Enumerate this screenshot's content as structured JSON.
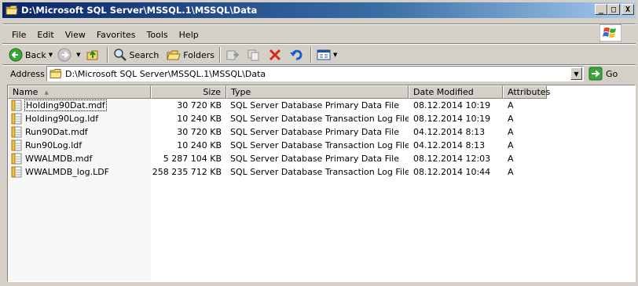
{
  "window": {
    "title": "D:\\Microsoft SQL Server\\MSSQL.1\\MSSQL\\Data",
    "minimize": "_",
    "maximize": "□",
    "close": "X"
  },
  "menu": [
    "File",
    "Edit",
    "View",
    "Favorites",
    "Tools",
    "Help"
  ],
  "toolbar": {
    "back": "Back",
    "search": "Search",
    "folders": "Folders"
  },
  "address": {
    "label": "Address",
    "value": "D:\\Microsoft SQL Server\\MSSQL.1\\MSSQL\\Data",
    "go": "Go"
  },
  "list": {
    "columns": {
      "name": "Name",
      "size": "Size",
      "type": "Type",
      "date": "Date Modified",
      "attributes": "Attributes"
    },
    "rows": [
      {
        "name": "Holding90Dat.mdf",
        "size": "30 720 KB",
        "type": "SQL Server Database Primary Data File",
        "date": "08.12.2014 10:19",
        "attr": "A"
      },
      {
        "name": "Holding90Log.ldf",
        "size": "10 240 KB",
        "type": "SQL Server Database Transaction Log File",
        "date": "08.12.2014 10:19",
        "attr": "A"
      },
      {
        "name": "Run90Dat.mdf",
        "size": "30 720 KB",
        "type": "SQL Server Database Primary Data File",
        "date": "04.12.2014 8:13",
        "attr": "A"
      },
      {
        "name": "Run90Log.ldf",
        "size": "10 240 KB",
        "type": "SQL Server Database Transaction Log File",
        "date": "04.12.2014 8:13",
        "attr": "A"
      },
      {
        "name": "WWALMDB.mdf",
        "size": "5 287 104 KB",
        "type": "SQL Server Database Primary Data File",
        "date": "08.12.2014 12:03",
        "attr": "A"
      },
      {
        "name": "WWALMDB_log.LDF",
        "size": "258 235 712 KB",
        "type": "SQL Server Database Transaction Log File",
        "date": "08.12.2014 10:44",
        "attr": "A"
      }
    ]
  }
}
